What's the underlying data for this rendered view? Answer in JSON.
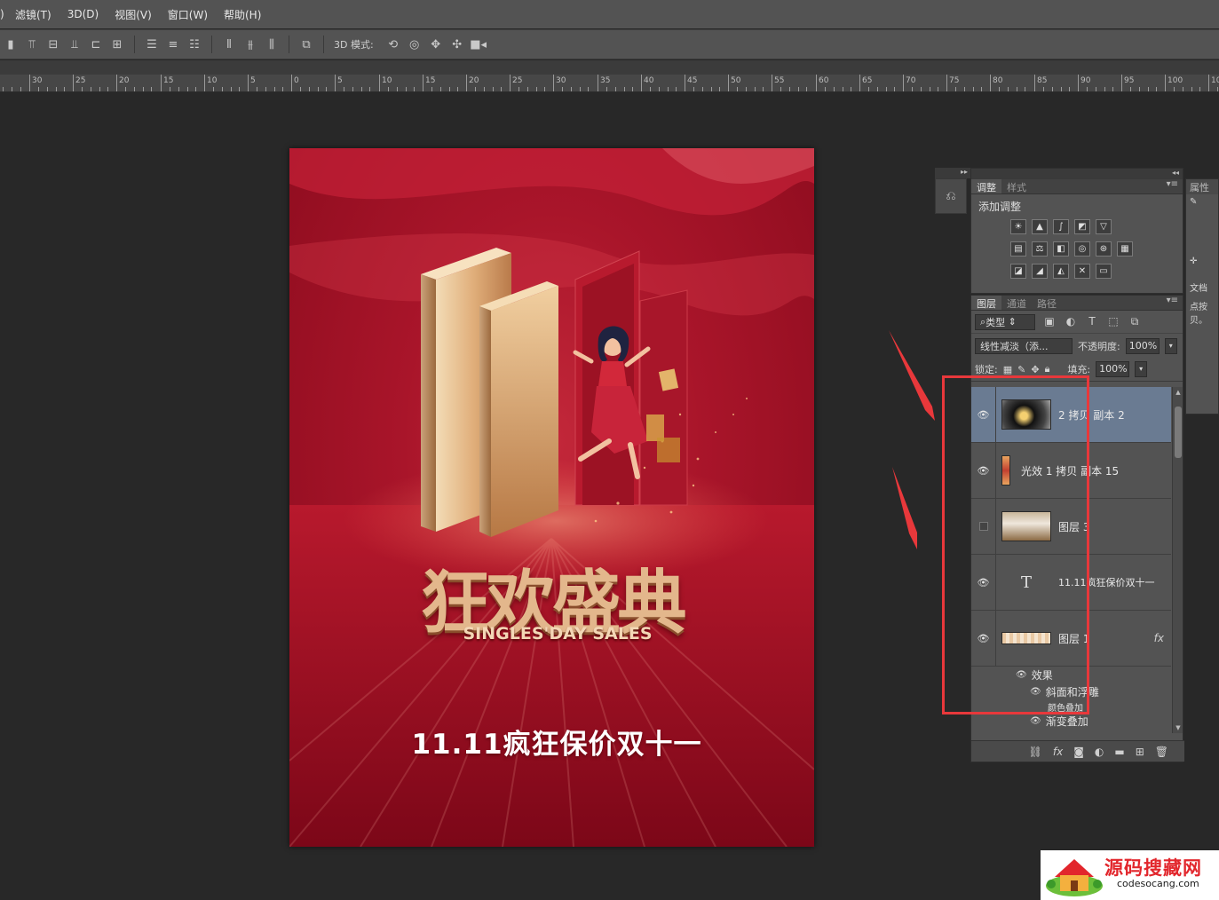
{
  "menubar": {
    "edge_glyph": ")",
    "items": [
      "滤镜(T)",
      "3D(D)",
      "视图(V)",
      "窗口(W)",
      "帮助(H)"
    ]
  },
  "options_bar": {
    "mode_label": "3D 模式:",
    "align_icons": [
      "align-top-icon",
      "align-vcenter-icon",
      "align-bottom-icon",
      "align-left-icon",
      "align-hcenter-icon",
      "align-right-icon"
    ],
    "mode_icons": [
      "3d-rotate-icon",
      "3d-roll-icon",
      "3d-pan-icon",
      "3d-slide-icon",
      "3d-scale-icon"
    ]
  },
  "ruler": {
    "labels": [
      "30",
      "25",
      "20",
      "15",
      "10",
      "5",
      "0",
      "5",
      "10",
      "15",
      "20",
      "25",
      "30",
      "35",
      "40",
      "45",
      "50",
      "55",
      "60",
      "65",
      "70",
      "75",
      "80",
      "85",
      "90",
      "95",
      "100",
      "10"
    ]
  },
  "poster": {
    "title": "狂欢盛典",
    "subtitle": "SINGLES'DAY SALES",
    "slogan": "11.11疯狂保价双十一",
    "colors": {
      "bg": "#a9152a",
      "gold": "#e3b78c",
      "text": "#ffffff"
    }
  },
  "adjustments_panel": {
    "tabs": [
      "调整",
      "样式"
    ],
    "active_tab": "调整",
    "add_label": "添加调整"
  },
  "properties_panel": {
    "tab": "属性",
    "doc_label": "文档",
    "hint": "点按贝。"
  },
  "layers_panel": {
    "tabs": [
      "图层",
      "通道",
      "路径"
    ],
    "active_tab": "图层",
    "filter_label": "类型",
    "blend_mode": "线性减淡（添...",
    "opacity_label": "不透明度:",
    "opacity_value": "100%",
    "lock_label": "锁定:",
    "fill_label": "填充:",
    "fill_value": "100%",
    "layers": [
      {
        "name": "2 拷贝 副本 2",
        "visible": true,
        "selected": true,
        "fx": ""
      },
      {
        "name": "光效 1 拷贝 副本 15",
        "visible": true,
        "selected": false,
        "fx": ""
      },
      {
        "name": "图层 3",
        "visible": false,
        "selected": false,
        "fx": ""
      },
      {
        "name": "11.11疯狂保价双十一",
        "visible": true,
        "selected": false,
        "fx": "",
        "type": "text"
      },
      {
        "name": "图层 1",
        "visible": true,
        "selected": false,
        "fx": "fx"
      }
    ],
    "type_glyph": "T",
    "effects_label": "效果",
    "effects": [
      "斜面和浮雕",
      "颜色叠加",
      "渐变叠加"
    ]
  },
  "annotation": {
    "box_color": "#e8383b"
  },
  "watermark": {
    "title": "源码搜藏网",
    "url": "codesocang.com"
  }
}
